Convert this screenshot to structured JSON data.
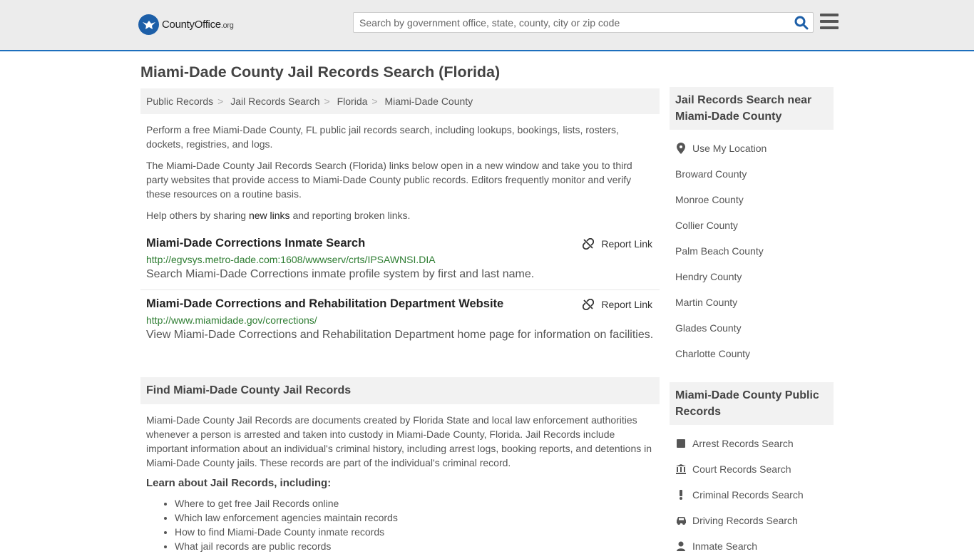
{
  "header": {
    "logo": {
      "brand": "CountyOffice",
      "tld": ".org"
    },
    "search": {
      "placeholder": "Search by government office, state, county, city or zip code"
    }
  },
  "page_title": "Miami-Dade County Jail Records Search (Florida)",
  "breadcrumb": [
    "Public Records",
    "Jail Records Search",
    "Florida",
    "Miami-Dade County"
  ],
  "intro": {
    "p1": "Perform a free Miami-Dade County, FL public jail records search, including lookups, bookings, lists, rosters, dockets, registries, and logs.",
    "p2": "The Miami-Dade County Jail Records Search (Florida) links below open in a new window and take you to third party websites that provide access to Miami-Dade County public records. Editors frequently monitor and verify these resources on a routine basis.",
    "p3_before": "Help others by sharing ",
    "p3_link": "new links",
    "p3_after": " and reporting broken links."
  },
  "results": [
    {
      "title": "Miami-Dade Corrections Inmate Search",
      "url": "http://egvsys.metro-dade.com:1608/wwwserv/crts/IPSAWNSI.DIA",
      "desc": "Search Miami-Dade Corrections inmate profile system by first and last name.",
      "report": "Report Link"
    },
    {
      "title": "Miami-Dade Corrections and Rehabilitation Department Website",
      "url": "http://www.miamidade.gov/corrections/",
      "desc": "View Miami-Dade Corrections and Rehabilitation Department home page for information on facilities.",
      "report": "Report Link"
    }
  ],
  "find_section": {
    "heading": "Find Miami-Dade County Jail Records",
    "body": "Miami-Dade County Jail Records are documents created by Florida State and local law enforcement authorities whenever a person is arrested and taken into custody in Miami-Dade County, Florida. Jail Records include important information about an individual's criminal history, including arrest logs, booking reports, and detentions in Miami-Dade County jails. These records are part of the individual's criminal record.",
    "learn_heading": "Learn about Jail Records, including:",
    "learn_items": [
      "Where to get free Jail Records online",
      "Which law enforcement agencies maintain records",
      "How to find Miami-Dade County inmate records",
      "What jail records are public records"
    ]
  },
  "sidebar_nearby": {
    "heading": "Jail Records Search near Miami-Dade County",
    "use_location": "Use My Location",
    "items": [
      "Broward County",
      "Monroe County",
      "Collier County",
      "Palm Beach County",
      "Hendry County",
      "Martin County",
      "Glades County",
      "Charlotte County"
    ]
  },
  "sidebar_public": {
    "heading": "Miami-Dade County Public Records",
    "items": [
      {
        "label": "Arrest Records Search",
        "icon": "square-icon"
      },
      {
        "label": "Court Records Search",
        "icon": "courthouse-icon"
      },
      {
        "label": "Criminal Records Search",
        "icon": "exclamation-icon"
      },
      {
        "label": "Driving Records Search",
        "icon": "car-icon"
      },
      {
        "label": "Inmate Search",
        "icon": "person-icon"
      }
    ]
  },
  "colors": {
    "accent": "#1d6fbd",
    "url_green": "#2e7d32",
    "panel": "#f2f2f2"
  }
}
